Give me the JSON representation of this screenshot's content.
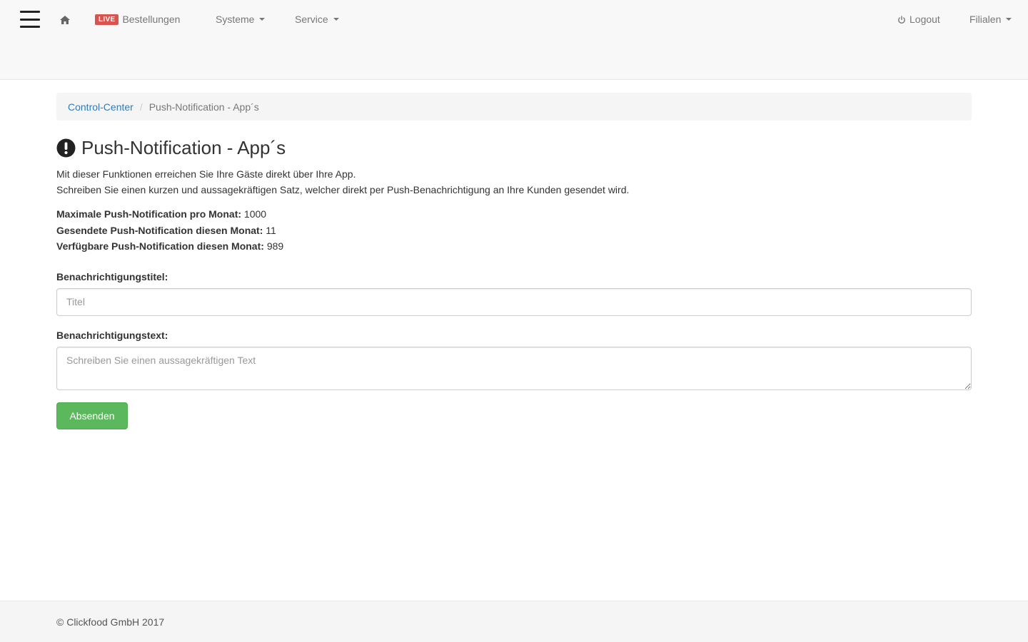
{
  "navbar": {
    "live_badge": "LIVE",
    "orders_label": "Bestellungen",
    "systems_label": "Systeme",
    "service_label": "Service",
    "logout_label": "Logout",
    "branches_label": "Filialen"
  },
  "breadcrumb": {
    "home": "Control-Center",
    "separator": "/",
    "current": "Push-Notification - App´s"
  },
  "page": {
    "title": "Push-Notification - App´s",
    "intro_line1": "Mit dieser Funktionen erreichen Sie Ihre Gäste direkt über Ihre App.",
    "intro_line2": "Schreiben Sie einen kurzen und aussagekräftigen Satz, welcher direkt per Push-Benachrichtigung an Ihre Kunden gesendet wird."
  },
  "stats": {
    "max_label": "Maximale Push-Notification pro Monat:",
    "max_value": "1000",
    "sent_label": "Gesendete Push-Notification diesen Monat:",
    "sent_value": "11",
    "available_label": "Verfügbare Push-Notification diesen Monat:",
    "available_value": "989"
  },
  "form": {
    "title_label": "Benachrichtigungstitel:",
    "title_placeholder": "Titel",
    "text_label": "Benachrichtigungstext:",
    "text_placeholder": "Schreiben Sie einen aussagekräftigen Text",
    "submit_label": "Absenden"
  },
  "footer": {
    "copyright": "© Clickfood GmbH 2017"
  },
  "icons": {
    "menu": "hamburger-menu-icon",
    "home": "home-icon",
    "power": "power-icon",
    "alert": "exclamation-circle-icon"
  },
  "colors": {
    "link": "#337ab7",
    "live_badge": "#d9534f",
    "submit": "#5cb85c"
  }
}
